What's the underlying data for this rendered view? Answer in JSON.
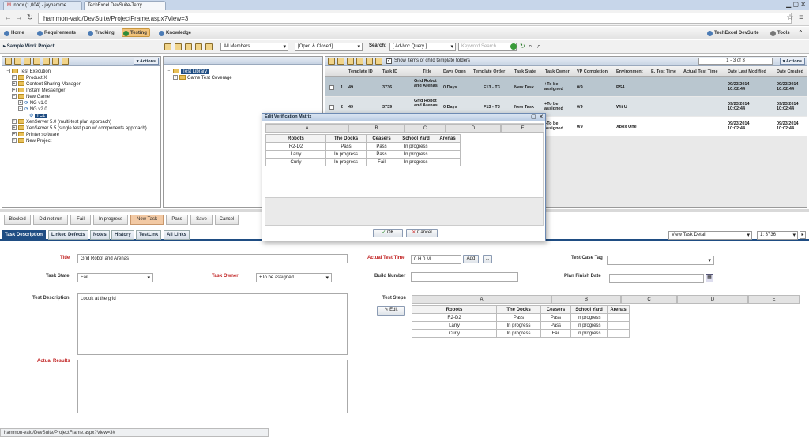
{
  "browser": {
    "tabs": [
      "Inbox (1,004) - jayhamme",
      "TechExcel DevSuite-Terry"
    ],
    "url": "hammon-vaio/DevSuite/ProjectFrame.aspx?View=3"
  },
  "nav": {
    "items": [
      "Home",
      "Requirements",
      "Tracking",
      "Testing",
      "Knowledge"
    ],
    "right_items": [
      "TechExcel DevSuite",
      "Tools"
    ]
  },
  "toolbar": {
    "project": "Sample Work Project",
    "members": "All Members",
    "status": "[Open & Closed]",
    "search_label": "Search:",
    "query": "[ Ad-hoc Query ]",
    "keyword_placeholder": "Keyword Search..."
  },
  "left_tree": {
    "actions": "Actions",
    "items": [
      "Test Execution",
      "Product X",
      "Content Sharing Manager",
      "Instant Messenger",
      "New Game",
      "NG v1.0",
      "NG v2.0",
      "TC1",
      "XenServer 5.0 (multi-test plan approach)",
      "XenServer 5.5 (single test plan w/ components approach)",
      "Printer software",
      "New Project"
    ]
  },
  "mid_tree": {
    "items": [
      "Test Library",
      "Game Test Coverage"
    ]
  },
  "grid": {
    "show_child_label": "Show items of child template folders",
    "pager": "1 - 3 of 3",
    "actions": "Actions",
    "headers": [
      "Template ID",
      "Task ID",
      "Title",
      "Days Open",
      "Template Order",
      "Task State",
      "Task Owner",
      "VP Completion",
      "Environment",
      "E. Test Time",
      "Actual Test Time",
      "Date Last Modified",
      "Date Created"
    ],
    "rows": [
      {
        "num": "1",
        "template_id": "49",
        "task_id": "3736",
        "title": "Grid Robot and Arenas",
        "days": "0 Days",
        "order": "F13 - T3",
        "state": "New Task",
        "owner": "+To be assigned",
        "vp": "0/9",
        "env": "PS4",
        "modified": "09/23/2014 10:02:44",
        "created": "09/23/2014 10:02:44"
      },
      {
        "num": "2",
        "template_id": "49",
        "task_id": "3739",
        "title": "Grid Robot and Arenas",
        "days": "0 Days",
        "order": "F13 - T3",
        "state": "New Task",
        "owner": "+To be assigned",
        "vp": "0/9",
        "env": "Wii U",
        "modified": "09/23/2014 10:02:44",
        "created": "09/23/2014 10:02:44"
      },
      {
        "num": "3",
        "template_id": "",
        "task_id": "",
        "title": "",
        "days": "",
        "order": "",
        "state": "",
        "owner": "+To be assigned",
        "vp": "0/9",
        "env": "Xbox One",
        "modified": "09/23/2014 10:02:44",
        "created": "09/23/2014 10:02:44"
      }
    ]
  },
  "dialog": {
    "title": "Edit Verification Matrix",
    "col_headers": [
      "A",
      "B",
      "C",
      "D",
      "E"
    ],
    "ok": "OK",
    "cancel": "Cancel"
  },
  "matrix": {
    "header": [
      "Robots",
      "The Docks",
      "Ceasers",
      "School Yard",
      "Arenas"
    ],
    "rows": [
      [
        "R2-D2",
        "Pass",
        "Pass",
        "In progress"
      ],
      [
        "Larry",
        "In progress",
        "Pass",
        "In progress"
      ],
      [
        "Curly",
        "In progress",
        "Fail",
        "In progress"
      ]
    ]
  },
  "status_buttons": [
    "Blocked",
    "Did not run",
    "Fail",
    "In progress",
    "New Task",
    "Pass",
    "Save",
    "Cancel"
  ],
  "detail_tabs": [
    "Task Description",
    "Linked Defects",
    "Notes",
    "History",
    "TestLink",
    "All Links"
  ],
  "view_select": "View Task Detail",
  "record_select": "1: 3736",
  "form": {
    "title_label": "Title",
    "title_value": "Grid Robot and Arenas",
    "task_state_label": "Task State",
    "task_state_value": "Fail",
    "task_owner_label": "Task Owner",
    "task_owner_value": "+To be assigned",
    "test_desc_label": "Test Description",
    "test_desc_value": "Loook at the grid",
    "actual_results_label": "Actual Results",
    "actual_time_label": "Actual Test Time",
    "actual_time_value": "0 H 0 M",
    "add": "Add",
    "more": "...",
    "build_label": "Build Number",
    "case_tag_label": "Test Case Tag",
    "plan_finish_label": "Plan Finish Date",
    "test_steps_label": "Test Steps",
    "edit": "Edit"
  },
  "status_text": "hammon-vaio/DevSuite/ProjectFrame.aspx?View=3#"
}
